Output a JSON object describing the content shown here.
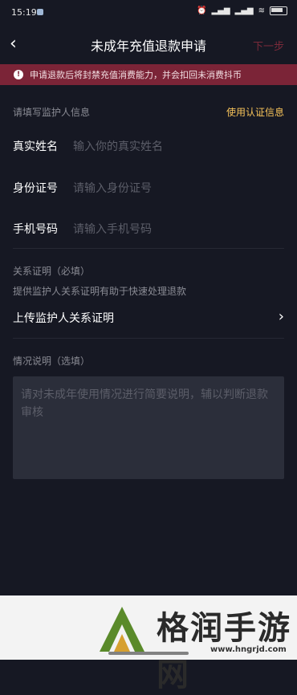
{
  "status_bar": {
    "time": "15:19",
    "battery": "88"
  },
  "nav": {
    "back_glyph": "‹",
    "title": "未成年充值退款申请",
    "next_label": "下一步"
  },
  "banner": {
    "icon": "!",
    "text": "申请退款后将封禁充值消费能力，并会扣回未消费抖币"
  },
  "guardian": {
    "section_label": "请填写监护人信息",
    "use_cert_link": "使用认证信息",
    "fields": [
      {
        "label": "真实姓名",
        "placeholder": "输入你的真实姓名"
      },
      {
        "label": "身份证号",
        "placeholder": "请输入身份证号"
      },
      {
        "label": "手机号码",
        "placeholder": "请输入手机号码"
      }
    ]
  },
  "relationship": {
    "title": "关系证明（必填）",
    "hint": "提供监护人关系证明有助于快速处理退款",
    "upload_label": "上传监护人关系证明",
    "chevron": "›"
  },
  "situation": {
    "title": "情况说明（选填）",
    "placeholder": "请对未成年使用情况进行简要说明，辅以判断退款审核"
  },
  "watermark": {
    "name": "格润手游网",
    "url": "www.hngrjd.com"
  },
  "colors": {
    "background": "#161823",
    "banner": "#7b2437",
    "accent_link": "#f7c35a",
    "next_disabled": "#7a2a3a"
  }
}
